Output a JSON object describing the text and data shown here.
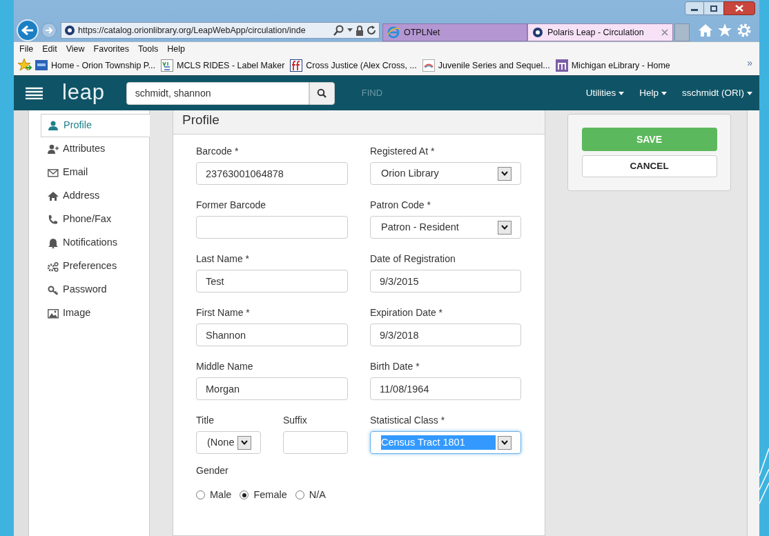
{
  "browser": {
    "address": "https://catalog.orionlibrary.org/LeapWebApp/circulation/inde",
    "tabs": [
      {
        "label": "OTPLNet",
        "selected": false
      },
      {
        "label": "Polaris Leap - Circulation",
        "selected": true
      }
    ],
    "menu": [
      "File",
      "Edit",
      "View",
      "Favorites",
      "Tools",
      "Help"
    ],
    "favorites": [
      "Home - Orion Township P...",
      "MCLS RIDES - Label Maker",
      "Cross Justice (Alex Cross, ...",
      "Juvenile Series and Sequel...",
      "Michigan eLibrary - Home"
    ],
    "favorites_more": "»"
  },
  "app": {
    "logo": "leap",
    "search": {
      "value": "schmidt, shannon"
    },
    "find": "FIND",
    "menus": [
      "Utilities",
      "Help",
      "sschmidt (ORI)"
    ]
  },
  "sidebar": {
    "items": [
      {
        "label": "Profile",
        "selected": true
      },
      {
        "label": "Attributes",
        "selected": false
      },
      {
        "label": "Email",
        "selected": false
      },
      {
        "label": "Address",
        "selected": false
      },
      {
        "label": "Phone/Fax",
        "selected": false
      },
      {
        "label": "Notifications",
        "selected": false
      },
      {
        "label": "Preferences",
        "selected": false
      },
      {
        "label": "Password",
        "selected": false
      },
      {
        "label": "Image",
        "selected": false
      }
    ]
  },
  "form": {
    "title": "Profile",
    "fields": [
      {
        "kind": "input",
        "label": "Barcode *",
        "value": "23763001064878"
      },
      {
        "kind": "select",
        "label": "Registered At *",
        "value": "Orion Library",
        "focused": false
      },
      {
        "kind": "input",
        "label": "Former Barcode"
      },
      {
        "kind": "select",
        "label": "Patron Code *",
        "value": "Patron - Resident",
        "focused": false
      },
      {
        "kind": "input",
        "label": "Last Name *",
        "value": "Test"
      },
      {
        "kind": "input",
        "label": "Date of Registration",
        "value": "9/3/2015"
      },
      {
        "kind": "input",
        "label": "First Name *",
        "value": "Shannon"
      },
      {
        "kind": "input",
        "label": "Expiration Date *",
        "value": "9/3/2018"
      },
      {
        "kind": "input",
        "label": "Middle Name",
        "value": "Morgan"
      },
      {
        "kind": "input",
        "label": "Birth Date *",
        "value": "11/08/1964"
      },
      {
        "kind": "short_select",
        "label": "Title",
        "value": "(None",
        "focused": false
      },
      {
        "kind": "short_input",
        "label": "Suffix"
      },
      {
        "kind": "select",
        "label": "Statistical Class *",
        "value": "Census Tract 1801",
        "focused": true
      }
    ],
    "gender": {
      "label": "Gender",
      "options": [
        {
          "label": "Male",
          "selected": false
        },
        {
          "label": "Female",
          "selected": true
        },
        {
          "label": "N/A",
          "selected": false
        }
      ]
    }
  },
  "actions": {
    "save": "SAVE",
    "cancel": "CANCEL"
  }
}
